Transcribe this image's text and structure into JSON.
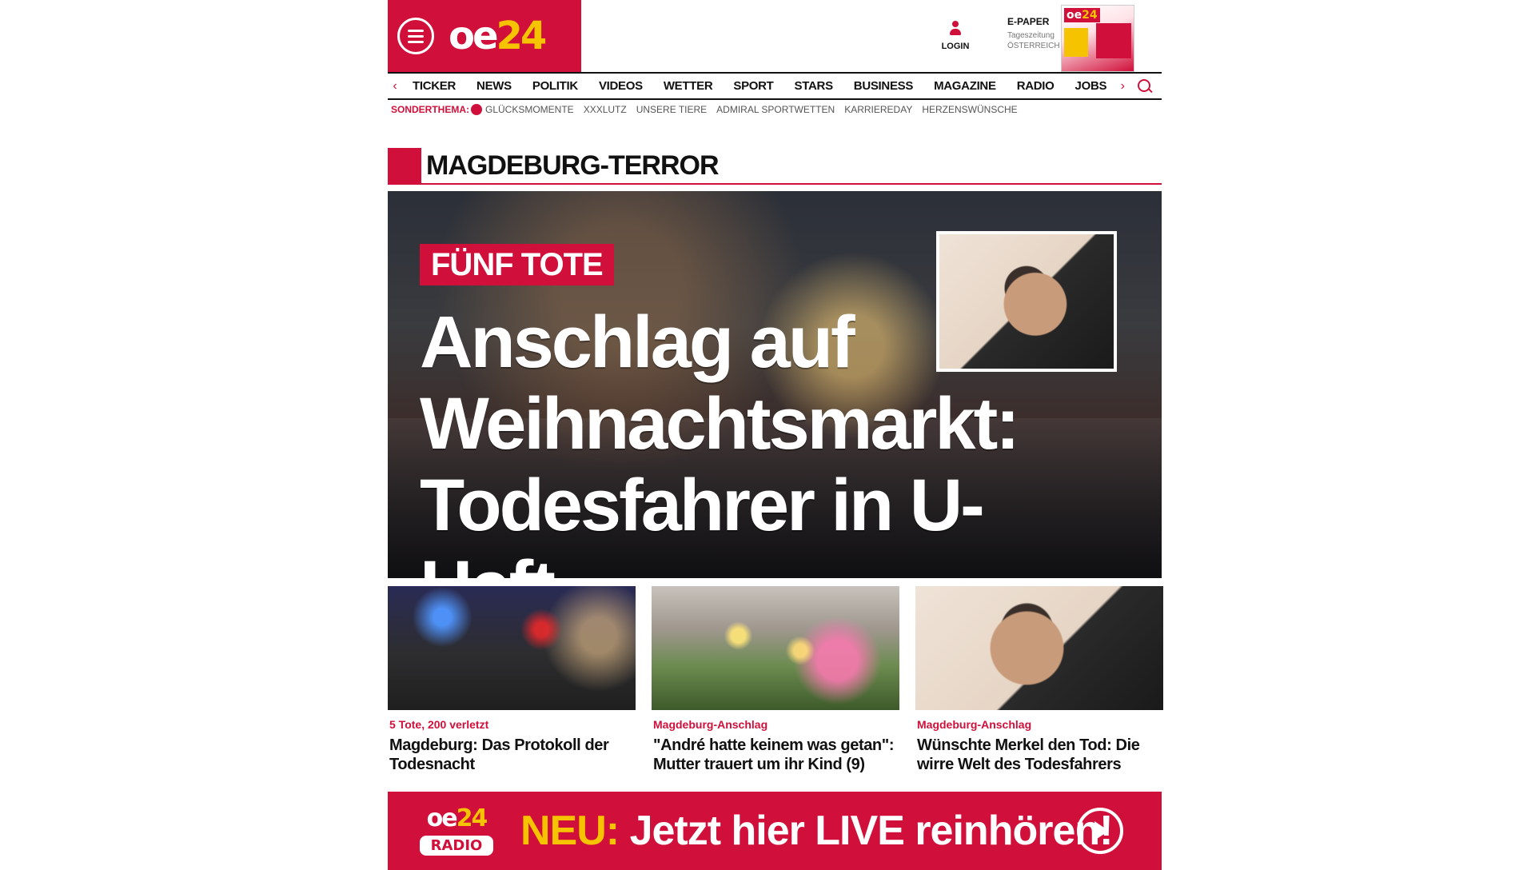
{
  "brand": {
    "logo_letters": "oe",
    "logo_number": "24",
    "primary_color": "#d0103a",
    "accent_color": "#f5c300"
  },
  "header": {
    "login_label": "LOGIN",
    "epaper": {
      "title": "E-PAPER",
      "subtitle_line1": "Tageszeitung",
      "subtitle_line2": "ÖSTERREICH"
    }
  },
  "nav": {
    "items": [
      {
        "label": "TICKER"
      },
      {
        "label": "NEWS"
      },
      {
        "label": "POLITIK"
      },
      {
        "label": "VIDEOS"
      },
      {
        "label": "WETTER"
      },
      {
        "label": "SPORT"
      },
      {
        "label": "STARS"
      },
      {
        "label": "BUSINESS"
      },
      {
        "label": "MAGAZINE"
      },
      {
        "label": "RADIO"
      },
      {
        "label": "JOBS"
      }
    ],
    "left_arrow_icon": "chevron-left-icon",
    "right_arrow_icon": "chevron-right-icon",
    "search_icon": "search-icon"
  },
  "subnav": {
    "label": "SONDERTHEMA:",
    "links": [
      {
        "label": "GLÜCKSMOMENTE"
      },
      {
        "label": "XXXLUTZ"
      },
      {
        "label": "UNSERE TIERE"
      },
      {
        "label": "ADMIRAL SPORTWETTEN"
      },
      {
        "label": "KARRIEREDAY"
      },
      {
        "label": "HERZENSWÜNSCHE"
      }
    ]
  },
  "section": {
    "title": "MAGDEBURG-TERROR"
  },
  "hero": {
    "badge": "FÜNF TOTE",
    "headline_line1": "Anschlag auf",
    "headline_line2": "Weihnachtsmarkt:",
    "headline_line3": "Todesfahrer in U-Haft"
  },
  "teasers": [
    {
      "kicker": "5 Tote, 200 verletzt",
      "title": "Magdeburg: Das Protokoll der Todesnacht"
    },
    {
      "kicker": "Magdeburg-Anschlag",
      "title": "\"André hatte keinem was getan\": Mutter trauert um ihr Kind (9)"
    },
    {
      "kicker": "Magdeburg-Anschlag",
      "title": "Wünschte Merkel den Tod: Die wirre Welt des Todesfahrers"
    }
  ],
  "radio_banner": {
    "logo_top_letters": "oe",
    "logo_top_number": "24",
    "logo_bottom": "RADIO",
    "prefix": "NEU:",
    "text": "Jetzt hier LIVE reinhören!",
    "play_icon": "play-icon"
  }
}
